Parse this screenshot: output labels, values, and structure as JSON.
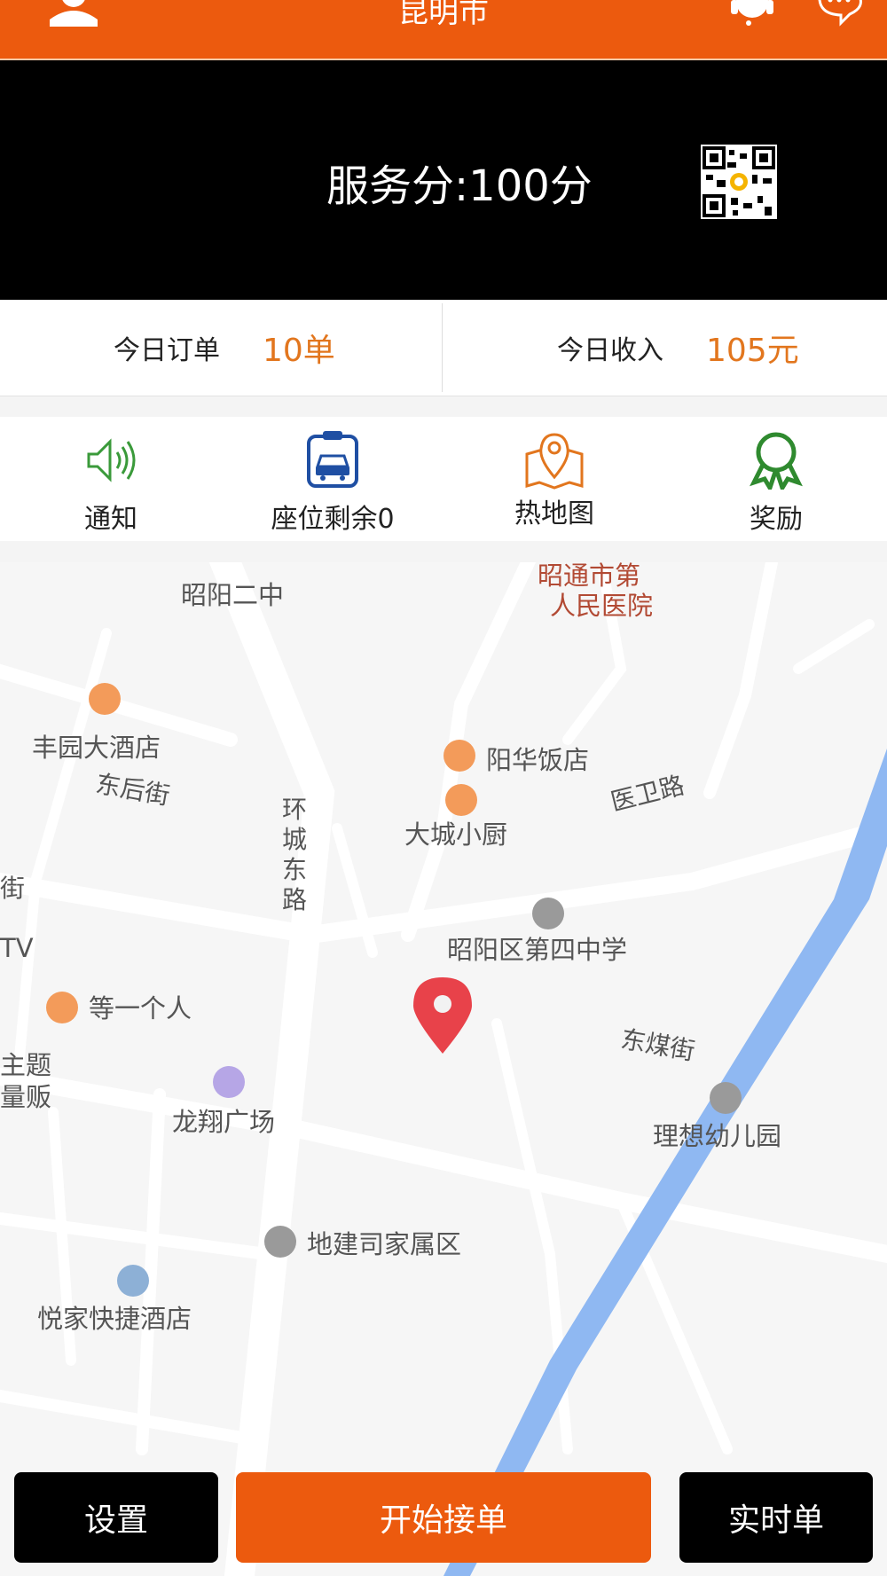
{
  "header": {
    "title": "昆明市"
  },
  "banner": {
    "score_text": "服务分:100分"
  },
  "stats": {
    "orders_label": "今日订单",
    "orders_value": "10单",
    "income_label": "今日收入",
    "income_value": "105元"
  },
  "quick_actions": [
    {
      "label": "通知",
      "icon": "speaker-icon",
      "color": "#3a9a3a"
    },
    {
      "label": "座位剩余0",
      "icon": "car-seat-icon",
      "color": "#1f4fa3"
    },
    {
      "label": "热地图",
      "icon": "map-pin-icon",
      "color": "#e2761e"
    },
    {
      "label": "奖励",
      "icon": "award-icon",
      "color": "#2f8a2f"
    }
  ],
  "map": {
    "pois": [
      {
        "label": "昭阳二中"
      },
      {
        "label": "昭通市第"
      },
      {
        "label": "人民医院"
      },
      {
        "label": "丰园大酒店"
      },
      {
        "label": "阳华饭店"
      },
      {
        "label": "大城小厨"
      },
      {
        "label": "昭阳区第四中学"
      },
      {
        "label": "等一个人"
      },
      {
        "label": "龙翔广场"
      },
      {
        "label": "理想幼儿园"
      },
      {
        "label": "地建司家属区"
      },
      {
        "label": "悦家快捷酒店"
      },
      {
        "label": "TV"
      },
      {
        "label": "主题"
      },
      {
        "label": "量贩"
      }
    ],
    "roads": [
      {
        "label": "医卫路"
      },
      {
        "label": "东后街"
      },
      {
        "label": "环城东路"
      },
      {
        "label": "东煤街"
      },
      {
        "label": "街"
      }
    ]
  },
  "bottom_bar": {
    "settings": "设置",
    "start": "开始接单",
    "realtime": "实时单"
  },
  "colors": {
    "brand": "#ec5a0e",
    "accent_text": "#e2761e",
    "river": "#8fb8f2"
  }
}
